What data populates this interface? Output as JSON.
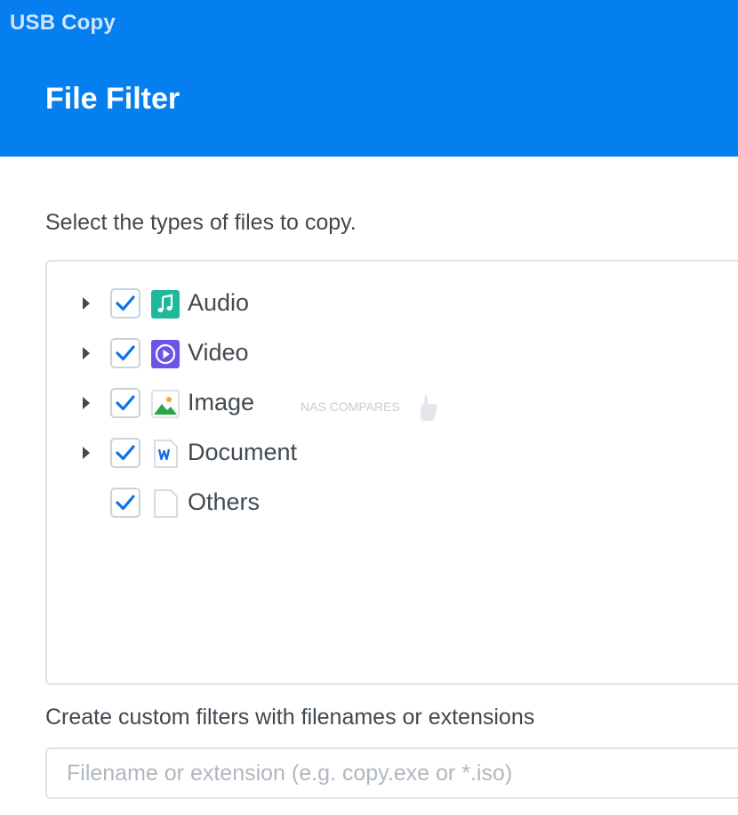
{
  "app": {
    "title": "USB Copy"
  },
  "page": {
    "title": "File Filter"
  },
  "instruction": "Select the types of files to copy.",
  "file_types": [
    {
      "label": "Audio",
      "checked": true,
      "expandable": true,
      "icon": "music-note-icon",
      "color": "#1fb89a"
    },
    {
      "label": "Video",
      "checked": true,
      "expandable": true,
      "icon": "play-circle-icon",
      "color": "#6a55e6"
    },
    {
      "label": "Image",
      "checked": true,
      "expandable": true,
      "icon": "picture-icon",
      "color": "#29a74b"
    },
    {
      "label": "Document",
      "checked": true,
      "expandable": true,
      "icon": "word-document-icon",
      "color": "#1b6fd8"
    },
    {
      "label": "Others",
      "checked": true,
      "expandable": false,
      "icon": "blank-file-icon",
      "color": "#c9d0d6"
    }
  ],
  "watermark": "NAS COMPARES",
  "custom_filter": {
    "label": "Create custom filters with filenames or extensions",
    "placeholder": "Filename or extension (e.g. copy.exe or *.iso)",
    "value": ""
  },
  "colors": {
    "header": "#057ff0",
    "check": "#0a74e8",
    "text": "#414a52"
  }
}
